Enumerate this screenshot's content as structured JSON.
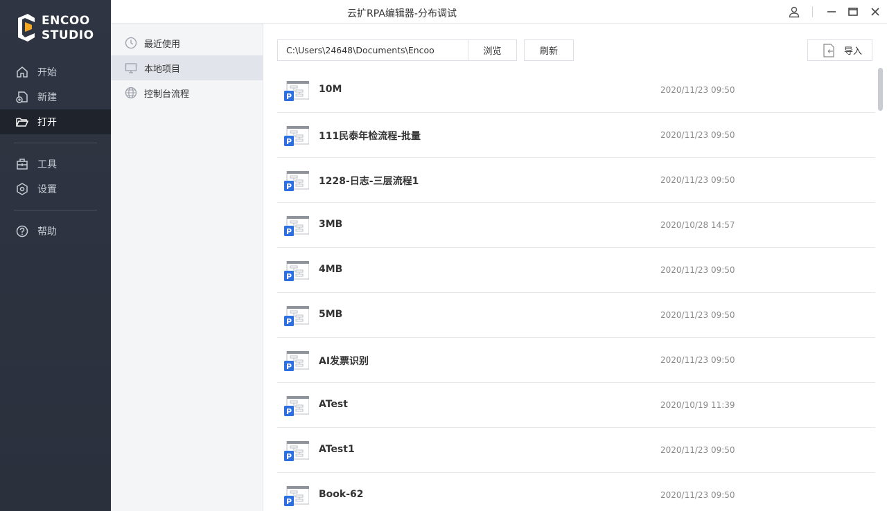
{
  "app": {
    "logo_line1": "ENCOO",
    "logo_line2": "STUDIO",
    "window_title": "云扩RPA编辑器-分布调试"
  },
  "nav": {
    "start": "开始",
    "new": "新建",
    "open": "打开",
    "tools": "工具",
    "settings": "设置",
    "help": "帮助"
  },
  "sub_nav": {
    "recent": "最近使用",
    "local": "本地项目",
    "console": "控制台流程"
  },
  "toolbar": {
    "path_value": "C:\\Users\\24648\\Documents\\Encoo",
    "browse_label": "浏览",
    "refresh_label": "刷新",
    "import_label": "导入"
  },
  "projects": [
    {
      "name": "10M",
      "date": "2020/11/23 09:50"
    },
    {
      "name": "111民泰年检流程-批量",
      "date": "2020/11/23 09:50"
    },
    {
      "name": "1228-日志-三层流程1",
      "date": "2020/11/23 09:50"
    },
    {
      "name": "3MB",
      "date": "2020/10/28 14:57"
    },
    {
      "name": "4MB",
      "date": "2020/11/23 09:50"
    },
    {
      "name": "5MB",
      "date": "2020/11/23 09:50"
    },
    {
      "name": "AI发票识别",
      "date": "2020/11/23 09:50"
    },
    {
      "name": "ATest",
      "date": "2020/10/19 11:39"
    },
    {
      "name": "ATest1",
      "date": "2020/11/23 09:50"
    },
    {
      "name": "Book-62",
      "date": "2020/11/23 09:50"
    }
  ],
  "colors": {
    "sidebar_bg": "#2f3542",
    "sidebar_active": "#1f232b",
    "accent_blue": "#2b6fe0",
    "logo_orange": "#f5a623"
  }
}
